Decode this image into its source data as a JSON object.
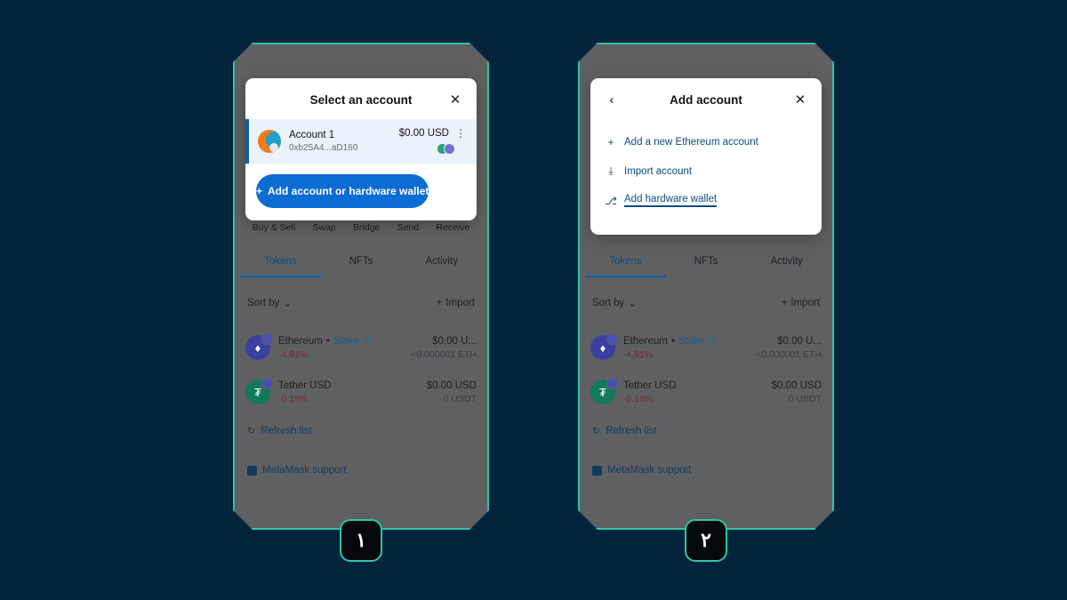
{
  "theme": {
    "page_bg": "#04243c",
    "panel_bg": "#5f6061",
    "panel_border": "#2ec4a6",
    "accent_blue": "#0b6cd4",
    "link_blue": "#0b4a80",
    "negative_red": "#7a2a33",
    "badge_bg": "#06090c"
  },
  "panels": [
    {
      "badge": "۱",
      "modal": {
        "type": "select-account",
        "back_visible": false,
        "back_label": "‹",
        "title": "Select an account",
        "close_label": "✕",
        "account": {
          "name": "Account 1",
          "address": "0xb25A4...aD160",
          "balance": "$0.00 USD",
          "kebab_label": "⋮",
          "networks": [
            "usdt-network",
            "eth-network"
          ]
        },
        "add_button": {
          "plus": "+",
          "label": "Add account or hardware wallet"
        }
      }
    },
    {
      "badge": "۲",
      "modal": {
        "type": "add-account",
        "back_visible": true,
        "back_label": "‹",
        "title": "Add account",
        "close_label": "✕",
        "menu_items": [
          {
            "icon": "+",
            "icon_name": "plus-icon",
            "label": "Add a new Ethereum account",
            "focused": false
          },
          {
            "icon": "⤓",
            "icon_name": "import-icon",
            "label": "Import account",
            "focused": false
          },
          {
            "icon": "⎇",
            "icon_name": "hardware-wallet-icon",
            "label": "Add hardware wallet",
            "focused": true
          }
        ]
      }
    }
  ],
  "wallet": {
    "actions": [
      "Buy & Sell",
      "Swap",
      "Bridge",
      "Send",
      "Receive"
    ],
    "tabs": [
      {
        "label": "Tokens",
        "active": true
      },
      {
        "label": "NFTs",
        "active": false
      },
      {
        "label": "Activity",
        "active": false
      }
    ],
    "controls": {
      "sort_by": "Sort by",
      "sort_chevron": "⌄",
      "import_plus": "+",
      "import": "Import"
    },
    "tokens": [
      {
        "symbol_glyph": "♦",
        "icon_class": "eth",
        "name": "Ethereum",
        "separator": "•",
        "stake_label": "Stake",
        "stake_icon": "⚘",
        "change": "-4.91%",
        "fiat": "$0.00 U...",
        "amount": "<0.000001 ETH"
      },
      {
        "symbol_glyph": "₮",
        "icon_class": "usdt",
        "name": "Tether USD",
        "separator": "",
        "stake_label": "",
        "stake_icon": "",
        "change": "-0.18%",
        "fiat": "$0.00 USD",
        "amount": "0 USDT"
      }
    ],
    "footer": [
      {
        "icon": "↻",
        "icon_name": "refresh-icon",
        "label": "Refresh list"
      },
      {
        "icon": "",
        "icon_name": "metamask-support-icon",
        "label": "MetaMask support"
      }
    ]
  }
}
